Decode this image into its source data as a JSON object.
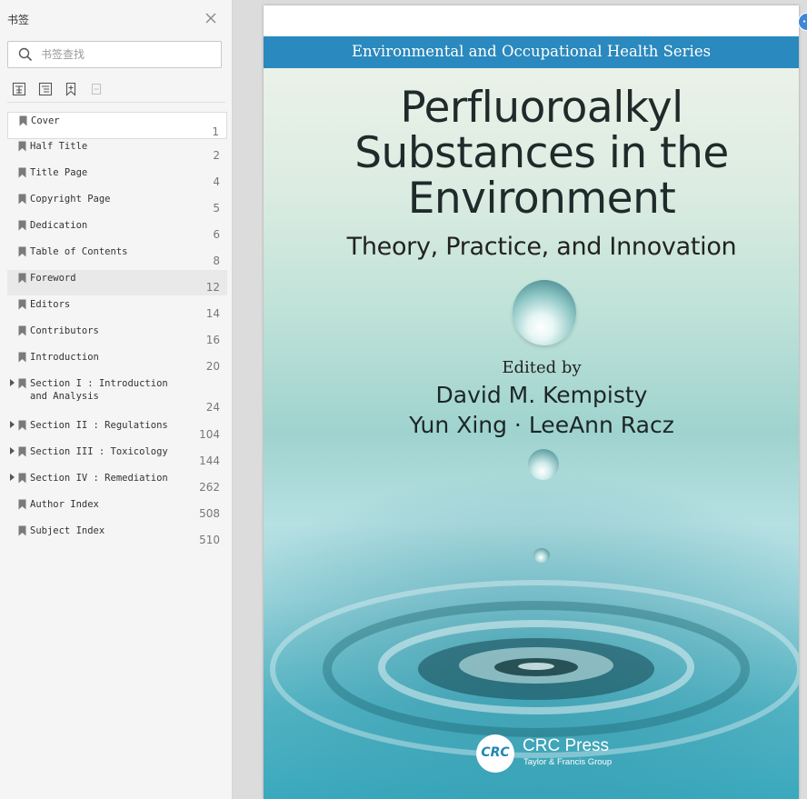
{
  "sidebar": {
    "title": "书签",
    "search_placeholder": "书签查找",
    "bookmarks": [
      {
        "label": "Cover",
        "page": "1"
      },
      {
        "label": "Half Title",
        "page": "2"
      },
      {
        "label": "Title Page",
        "page": "4"
      },
      {
        "label": "Copyright Page",
        "page": "5"
      },
      {
        "label": "Dedication",
        "page": "6"
      },
      {
        "label": "Table of Contents",
        "page": "8"
      },
      {
        "label": "Foreword",
        "page": "12"
      },
      {
        "label": "Editors",
        "page": "14"
      },
      {
        "label": "Contributors",
        "page": "16"
      },
      {
        "label": "Introduction",
        "page": "20"
      },
      {
        "label": "Section I : Introduction\nand Analysis",
        "page": "24"
      },
      {
        "label": "Section II : Regulations",
        "page": "104"
      },
      {
        "label": "Section III : Toxicology",
        "page": "144"
      },
      {
        "label": "Section IV : Remediation",
        "page": "262"
      },
      {
        "label": "Author Index",
        "page": "508"
      },
      {
        "label": "Subject Index",
        "page": "510"
      }
    ]
  },
  "cover": {
    "series": "Environmental and Occupational Health Series",
    "title_lines": [
      "Perfluoroalkyl",
      "Substances in the",
      "Environment"
    ],
    "subtitle": "Theory, Practice, and Innovation",
    "edited_by": "Edited by",
    "editor_line1": "David M. Kempisty",
    "editor_line2": "Yun Xing · LeeAnn Racz",
    "publisher_logo": "CRC",
    "publisher_name": "CRC Press",
    "publisher_sub": "Taylor & Francis Group"
  },
  "colors": {
    "series_bar": "#2a89be",
    "sidebar_bg": "#f5f5f5",
    "doc_bg": "#dcdcdc"
  }
}
